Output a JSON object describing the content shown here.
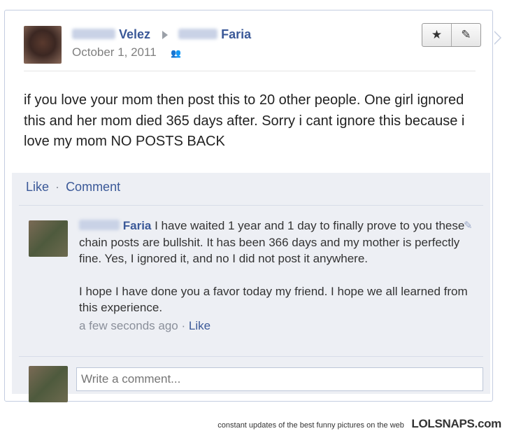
{
  "post": {
    "author_surname": "Velez",
    "recipient_surname": "Faria",
    "date": "October 1, 2011",
    "privacy_icon": "friends-icon",
    "text": "if you love your mom then post this to 20 other people. One girl ignored this and her mom died 365 days after. Sorry i cant ignore this because i love my mom NO POSTS BACK"
  },
  "toolbar": {
    "star_icon": "★",
    "edit_icon": "✎"
  },
  "actions": {
    "like": "Like",
    "separator": "·",
    "comment": "Comment"
  },
  "comment": {
    "author_surname": "Faria",
    "text1": " I have waited 1 year and 1 day to finally prove to you these chain posts are bullshit. It has been 366 days and my mother is perfectly fine. Yes, I ignored it, and no I did not post it anywhere.",
    "text2": "I hope I have done you a favor today my friend. I hope we all learned from this experience.",
    "time": "a few seconds ago",
    "separator": "·",
    "like": "Like"
  },
  "write_comment": {
    "placeholder": "Write a comment..."
  },
  "credit": {
    "tagline": "constant updates of the best funny pictures on the web",
    "brand": "LOLSNAPS.com"
  }
}
